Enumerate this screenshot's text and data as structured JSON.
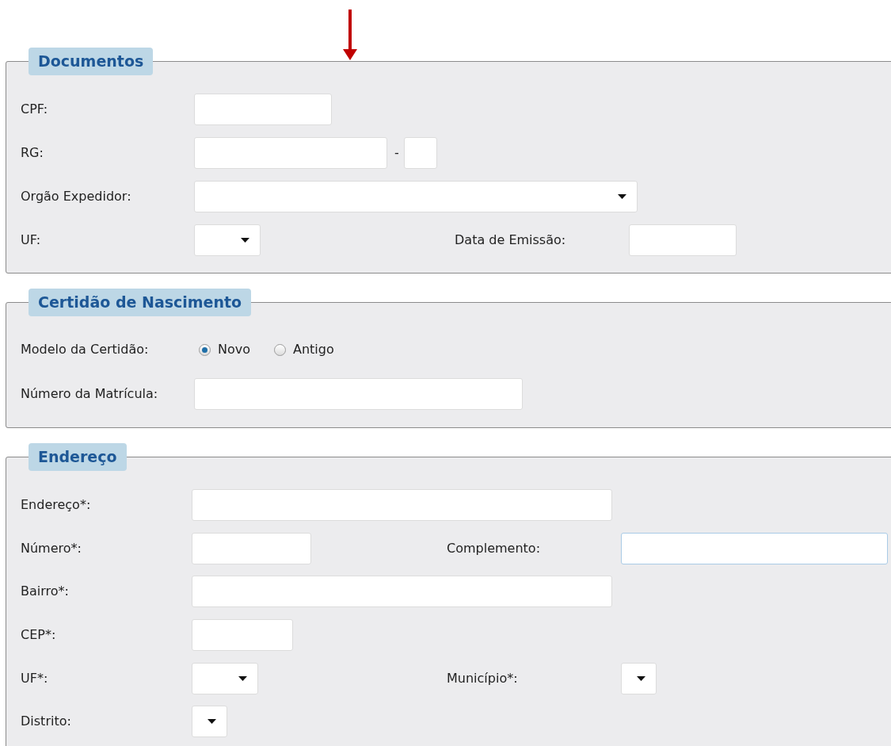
{
  "sections": [
    {
      "title": "Documentos",
      "rows": [
        {
          "items": [
            {
              "kind": "label",
              "text": "CPF:"
            },
            {
              "kind": "input",
              "focused": false
            }
          ]
        },
        {
          "items": [
            {
              "kind": "label",
              "text": "RG:"
            },
            {
              "kind": "input",
              "focused": false
            },
            {
              "kind": "separator",
              "text": "-"
            },
            {
              "kind": "input",
              "focused": false
            }
          ]
        },
        {
          "items": [
            {
              "kind": "label",
              "text": "Orgão Expedidor:"
            },
            {
              "kind": "select"
            }
          ]
        },
        {
          "items": [
            {
              "kind": "label",
              "text": "UF:"
            },
            {
              "kind": "select"
            },
            {
              "kind": "label",
              "text": "Data de Emissão:"
            },
            {
              "kind": "input",
              "focused": false
            }
          ]
        }
      ]
    },
    {
      "title": "Certidão de Nascimento",
      "rows": [
        {
          "items": [
            {
              "kind": "label",
              "text": "Modelo da Certidão:"
            },
            {
              "kind": "radio",
              "label": "Novo",
              "selected": true
            },
            {
              "kind": "radio",
              "label": "Antigo",
              "selected": false
            }
          ]
        },
        {
          "items": [
            {
              "kind": "label",
              "text": "Número da Matrícula:"
            },
            {
              "kind": "input",
              "focused": false
            }
          ]
        }
      ]
    },
    {
      "title": "Endereço",
      "rows": [
        {
          "items": [
            {
              "kind": "label",
              "text": "Endereço*:"
            },
            {
              "kind": "input",
              "focused": false
            }
          ]
        },
        {
          "items": [
            {
              "kind": "label",
              "text": "Número*:"
            },
            {
              "kind": "input",
              "focused": false
            },
            {
              "kind": "label",
              "text": "Complemento:"
            },
            {
              "kind": "input",
              "focused": true
            }
          ]
        },
        {
          "items": [
            {
              "kind": "label",
              "text": "Bairro*:"
            },
            {
              "kind": "input",
              "focused": false
            }
          ]
        },
        {
          "items": [
            {
              "kind": "label",
              "text": "CEP*:"
            },
            {
              "kind": "input",
              "focused": false
            }
          ]
        },
        {
          "items": [
            {
              "kind": "label",
              "text": "UF*:"
            },
            {
              "kind": "select"
            },
            {
              "kind": "label",
              "text": "Município*:"
            },
            {
              "kind": "select"
            }
          ]
        },
        {
          "items": [
            {
              "kind": "label",
              "text": "Distrito:"
            },
            {
              "kind": "select"
            }
          ]
        }
      ]
    }
  ]
}
